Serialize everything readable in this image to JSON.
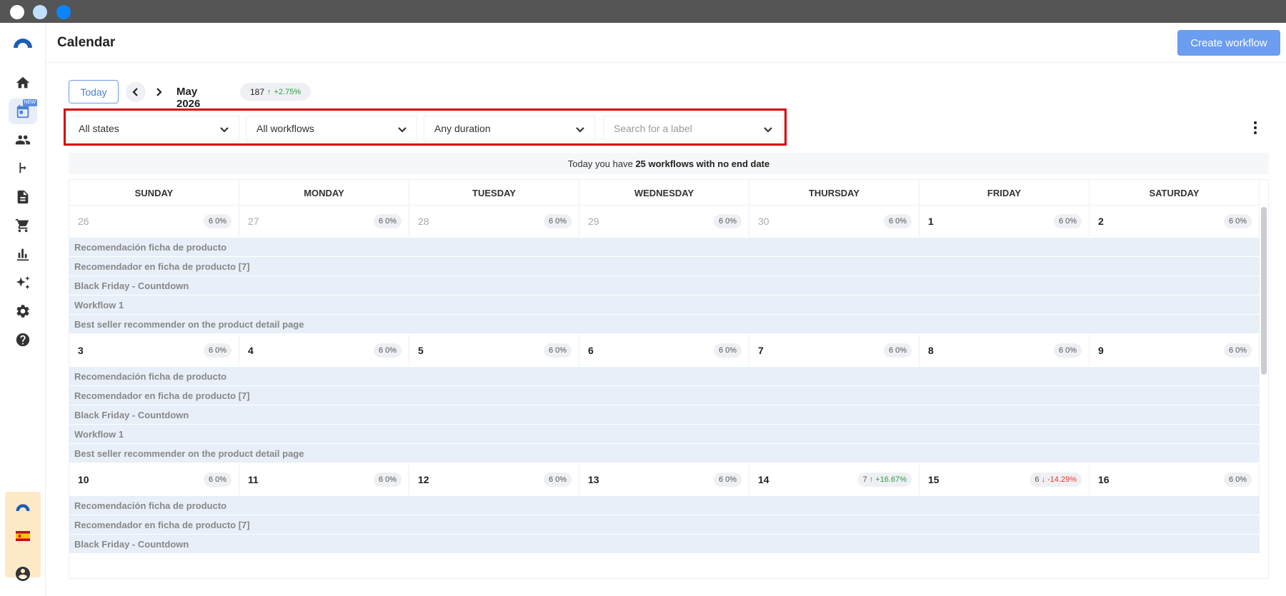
{
  "header": {
    "title": "Calendar",
    "create_label": "Create workflow"
  },
  "sidebar": {
    "new_badge": "NEW"
  },
  "toolbar": {
    "today_label": "Today",
    "month": "May 2026",
    "total": "187",
    "change": "+2.75%"
  },
  "filters": {
    "states": "All states",
    "workflows": "All workflows",
    "duration": "Any duration",
    "label_placeholder": "Search for a label"
  },
  "info": {
    "prefix": "Today you have",
    "bold": "25 workflows with no end date"
  },
  "days_of_week": [
    "SUNDAY",
    "MONDAY",
    "TUESDAY",
    "WEDNESDAY",
    "THURSDAY",
    "FRIDAY",
    "SATURDAY"
  ],
  "workflows": [
    "Recomendación ficha de producto",
    "Recomendador en ficha de producto [7]",
    "Black Friday - Countdown",
    "Workflow 1",
    "Best seller recommender on the product detail page"
  ],
  "weeks": [
    {
      "days": [
        {
          "num": "26",
          "muted": true,
          "count": "6",
          "pct": "0%",
          "trend": ""
        },
        {
          "num": "27",
          "muted": true,
          "count": "6",
          "pct": "0%",
          "trend": ""
        },
        {
          "num": "28",
          "muted": true,
          "count": "6",
          "pct": "0%",
          "trend": ""
        },
        {
          "num": "29",
          "muted": true,
          "count": "6",
          "pct": "0%",
          "trend": ""
        },
        {
          "num": "30",
          "muted": true,
          "count": "6",
          "pct": "0%",
          "trend": ""
        },
        {
          "num": "1",
          "muted": false,
          "count": "6",
          "pct": "0%",
          "trend": ""
        },
        {
          "num": "2",
          "muted": false,
          "count": "6",
          "pct": "0%",
          "trend": ""
        }
      ]
    },
    {
      "days": [
        {
          "num": "3",
          "muted": false,
          "count": "6",
          "pct": "0%",
          "trend": ""
        },
        {
          "num": "4",
          "muted": false,
          "count": "6",
          "pct": "0%",
          "trend": ""
        },
        {
          "num": "5",
          "muted": false,
          "count": "6",
          "pct": "0%",
          "trend": ""
        },
        {
          "num": "6",
          "muted": false,
          "count": "6",
          "pct": "0%",
          "trend": ""
        },
        {
          "num": "7",
          "muted": false,
          "count": "6",
          "pct": "0%",
          "trend": ""
        },
        {
          "num": "8",
          "muted": false,
          "count": "6",
          "pct": "0%",
          "trend": ""
        },
        {
          "num": "9",
          "muted": false,
          "count": "6",
          "pct": "0%",
          "trend": ""
        }
      ]
    },
    {
      "days": [
        {
          "num": "10",
          "muted": false,
          "count": "6",
          "pct": "0%",
          "trend": ""
        },
        {
          "num": "11",
          "muted": false,
          "count": "6",
          "pct": "0%",
          "trend": ""
        },
        {
          "num": "12",
          "muted": false,
          "count": "6",
          "pct": "0%",
          "trend": ""
        },
        {
          "num": "13",
          "muted": false,
          "count": "6",
          "pct": "0%",
          "trend": ""
        },
        {
          "num": "14",
          "muted": false,
          "count": "7",
          "pct": "+16.67%",
          "trend": "up"
        },
        {
          "num": "15",
          "muted": false,
          "count": "6",
          "pct": "-14.29%",
          "trend": "down"
        },
        {
          "num": "16",
          "muted": false,
          "count": "6",
          "pct": "0%",
          "trend": ""
        }
      ]
    }
  ],
  "visible_workflows_last_week": 3,
  "colors": {
    "accent": "#6b9df0",
    "highlight": "#d50000",
    "up": "#2e9a44",
    "down": "#e53935",
    "bar": "#e8eff8"
  }
}
